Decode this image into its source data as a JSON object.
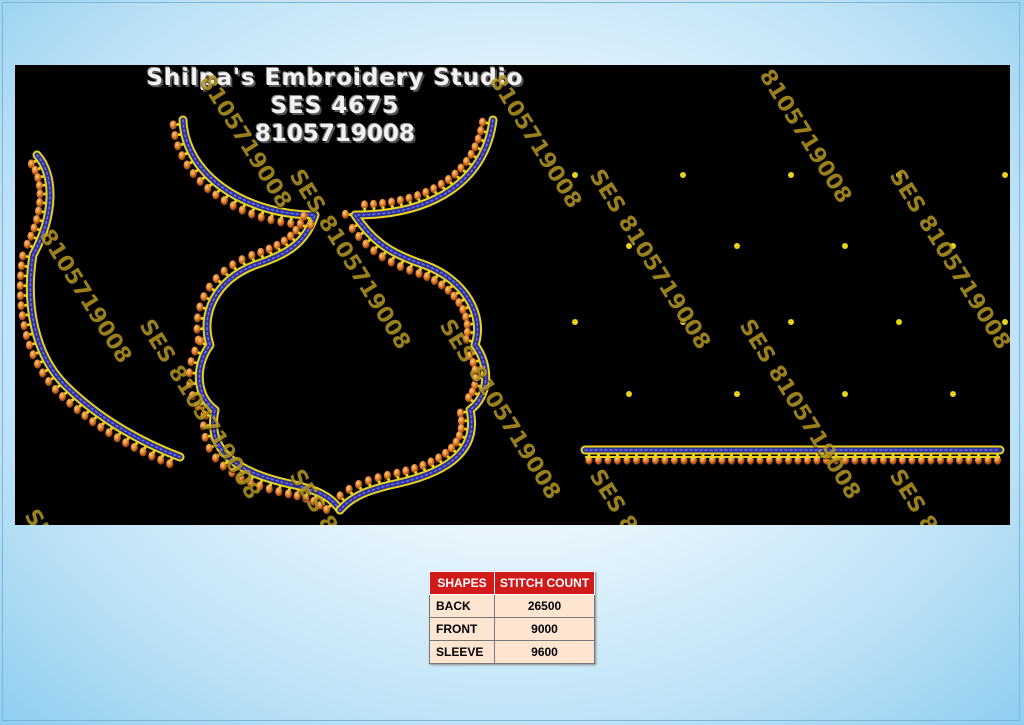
{
  "header": {
    "studio_name": "Shilpa's Embroidery Studio",
    "design_code": "SES 4675",
    "phone": "8105719008"
  },
  "watermark": {
    "text_full": "SES 8105719008",
    "text_partial_a": "8105719008",
    "text_partial_b": "SES 8105"
  },
  "colors": {
    "panel_bg": "#000000",
    "gold": "#e8d21a",
    "blue": "#2b2f9c",
    "orange": "#e07a2a",
    "table_header": "#d11a1a",
    "table_cell": "#fde5d2"
  },
  "stitch_table": {
    "headers": [
      "SHAPES",
      "STITCH COUNT"
    ],
    "rows": [
      {
        "shape": "BACK",
        "count": "26500"
      },
      {
        "shape": "FRONT",
        "count": "9000"
      },
      {
        "shape": "SLEEVE",
        "count": "9600"
      }
    ]
  }
}
